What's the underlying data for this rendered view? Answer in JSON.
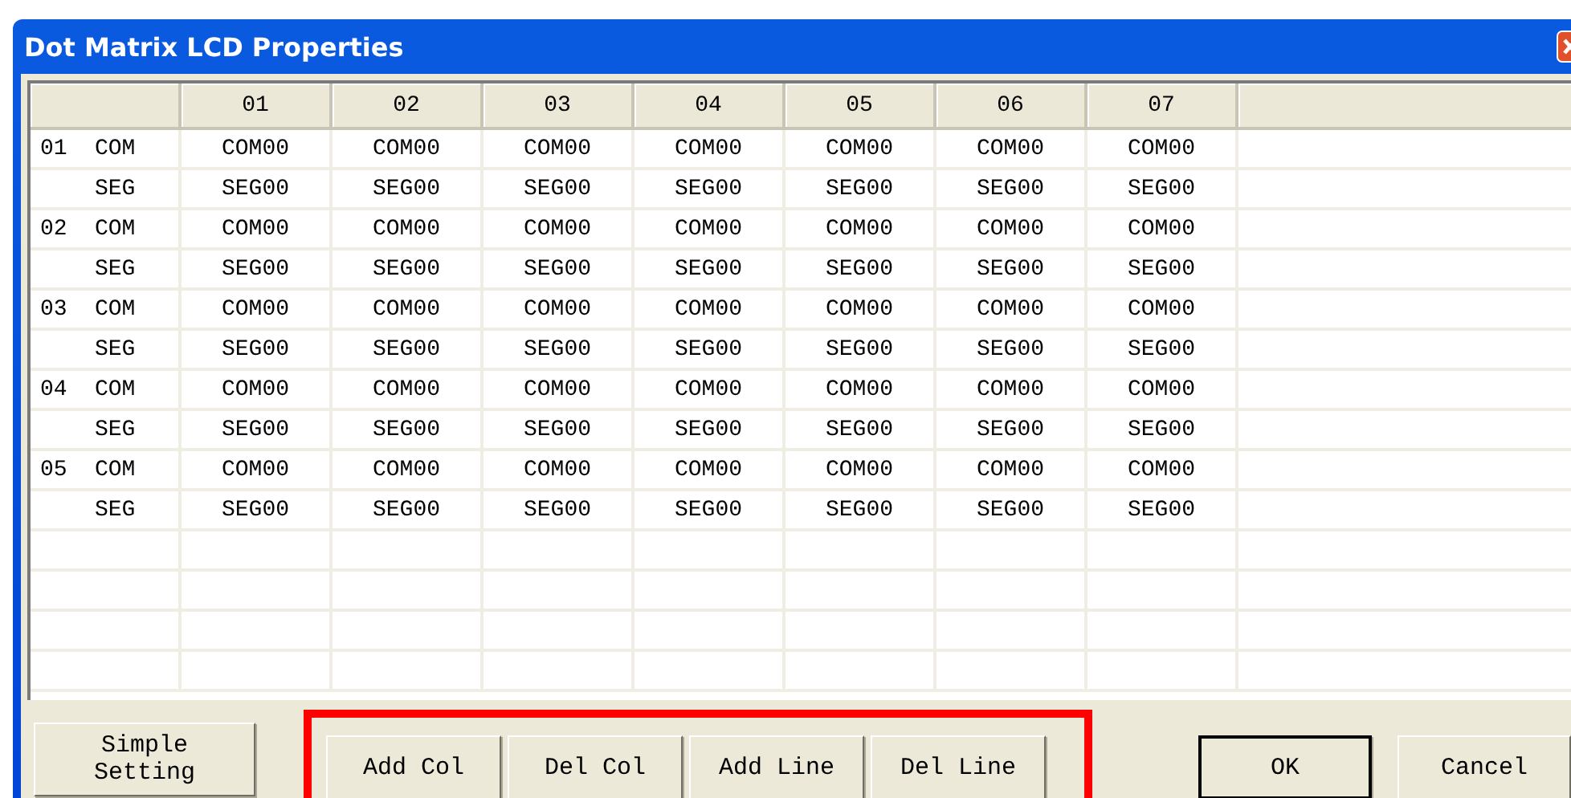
{
  "window": {
    "title": "Dot Matrix LCD Properties"
  },
  "table": {
    "columns": [
      "01",
      "02",
      "03",
      "04",
      "05",
      "06",
      "07"
    ],
    "rows": [
      {
        "index": "01",
        "type": "COM",
        "cells": [
          "COM00",
          "COM00",
          "COM00",
          "COM00",
          "COM00",
          "COM00",
          "COM00"
        ]
      },
      {
        "type": "SEG",
        "cells": [
          "SEG00",
          "SEG00",
          "SEG00",
          "SEG00",
          "SEG00",
          "SEG00",
          "SEG00"
        ]
      },
      {
        "index": "02",
        "type": "COM",
        "cells": [
          "COM00",
          "COM00",
          "COM00",
          "COM00",
          "COM00",
          "COM00",
          "COM00"
        ]
      },
      {
        "type": "SEG",
        "cells": [
          "SEG00",
          "SEG00",
          "SEG00",
          "SEG00",
          "SEG00",
          "SEG00",
          "SEG00"
        ]
      },
      {
        "index": "03",
        "type": "COM",
        "cells": [
          "COM00",
          "COM00",
          "COM00",
          "COM00",
          "COM00",
          "COM00",
          "COM00"
        ]
      },
      {
        "type": "SEG",
        "cells": [
          "SEG00",
          "SEG00",
          "SEG00",
          "SEG00",
          "SEG00",
          "SEG00",
          "SEG00"
        ]
      },
      {
        "index": "04",
        "type": "COM",
        "cells": [
          "COM00",
          "COM00",
          "COM00",
          "COM00",
          "COM00",
          "COM00",
          "COM00"
        ]
      },
      {
        "type": "SEG",
        "cells": [
          "SEG00",
          "SEG00",
          "SEG00",
          "SEG00",
          "SEG00",
          "SEG00",
          "SEG00"
        ]
      },
      {
        "index": "05",
        "type": "COM",
        "cells": [
          "COM00",
          "COM00",
          "COM00",
          "COM00",
          "COM00",
          "COM00",
          "COM00"
        ]
      },
      {
        "type": "SEG",
        "cells": [
          "SEG00",
          "SEG00",
          "SEG00",
          "SEG00",
          "SEG00",
          "SEG00",
          "SEG00"
        ]
      }
    ]
  },
  "setting_button": [
    "Simple",
    "Setting"
  ],
  "edit_buttons": {
    "highlighted": true,
    "items": [
      "Add Col",
      "Del Col",
      "Add Line",
      "Del Line"
    ]
  },
  "dialog_buttons": [
    {
      "label": "OK",
      "default": true
    },
    {
      "label": "Cancel",
      "default": false
    }
  ]
}
